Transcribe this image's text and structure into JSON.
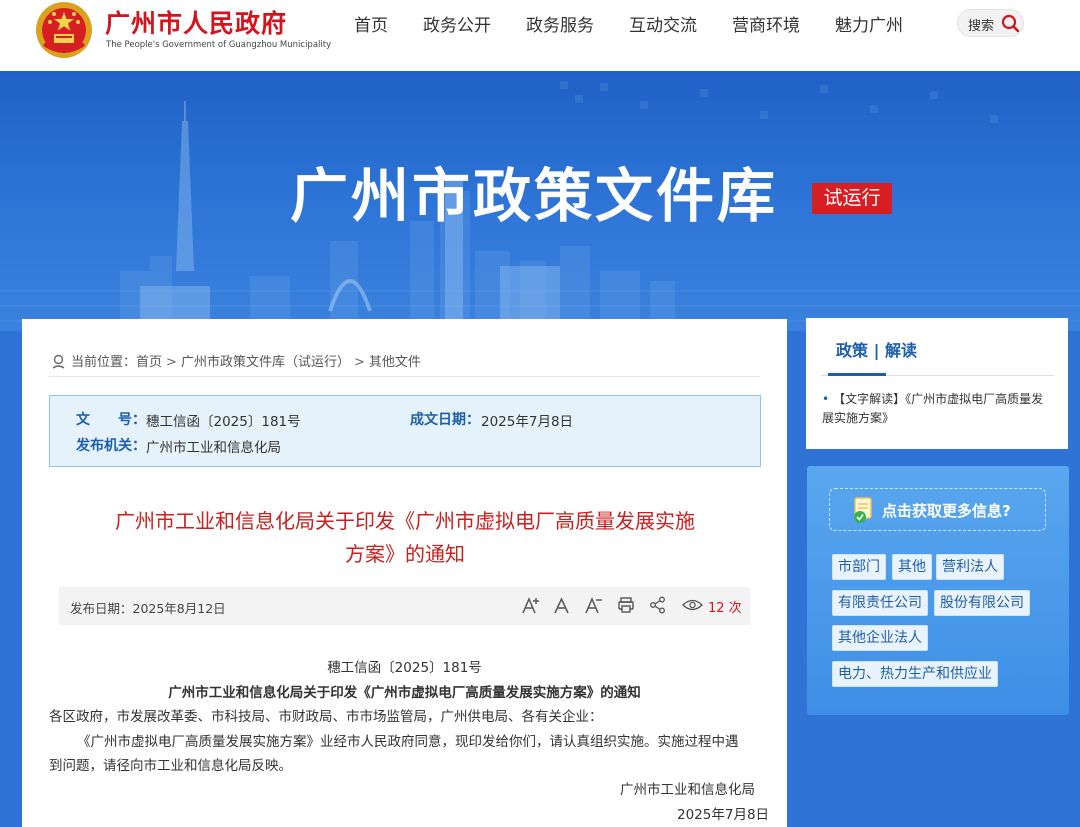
{
  "header": {
    "site_name": "广州市人民政府",
    "site_name_en": "The People's Government of Guangzhou Municipality",
    "nav": [
      "首页",
      "政务公开",
      "政务服务",
      "互动交流",
      "营商环境",
      "魅力广州"
    ],
    "search_label": "搜索"
  },
  "banner": {
    "title": "广州市政策文件库",
    "tag": "试运行"
  },
  "breadcrumb": {
    "prefix": "当前位置：",
    "items": [
      "首页",
      "广州市政策文件库（试运行）",
      "其他文件"
    ]
  },
  "meta": {
    "doc_no_label": "文　　号：",
    "doc_no": "穗工信函〔2025〕181号",
    "date_label": "成文日期：",
    "date": "2025年7月8日",
    "issuer_label": "发布机关：",
    "issuer": "广州市工业和信息化局"
  },
  "document": {
    "title_line1": "广州市工业和信息化局关于印发《广州市虚拟电厂高质量发展实施",
    "title_line2": "方案》的通知",
    "publish_date": "发布日期：2025年8月12日",
    "views": "12 次",
    "doc_number": "穗工信函〔2025〕181号",
    "heading": "广州市工业和信息化局关于印发《广州市虚拟电厂高质量发展实施方案》的通知",
    "recipients": "各区政府，市发展改革委、市科技局、市财政局、市市场监管局，广州供电局、各有关企业：",
    "para1": "《广州市虚拟电厂高质量发展实施方案》业经市人民政府同意，现印发给你们，请认真组织实施。实施过程中遇",
    "para2": "到问题，请径向市工业和信息化局反映。",
    "sign_org": "广州市工业和信息化局",
    "sign_date": "2025年7月8日"
  },
  "side": {
    "head": "政策 | 解读",
    "item": "【文字解读】《广州市虚拟电厂高质量发展实施方案》",
    "more_label": "点击获取更多信息?",
    "tags": [
      "市部门",
      "其他",
      "营利法人",
      "有限责任公司",
      "股份有限公司",
      "其他企业法人",
      "电力、热力生产和供应业"
    ]
  },
  "colors": {
    "brand_red": "#d4131d",
    "banner_blue": "#2f73d6",
    "label_blue": "#1f5fa9",
    "title_red": "#c9201e"
  },
  "icons": {
    "emblem": "national-emblem-icon",
    "search": "search-icon",
    "location": "location-pin-icon",
    "font_larger": "font-increase-icon",
    "font_default": "font-default-icon",
    "font_smaller": "font-decrease-icon",
    "print": "print-icon",
    "share": "share-icon",
    "views": "eye-icon",
    "more": "info-document-icon"
  }
}
